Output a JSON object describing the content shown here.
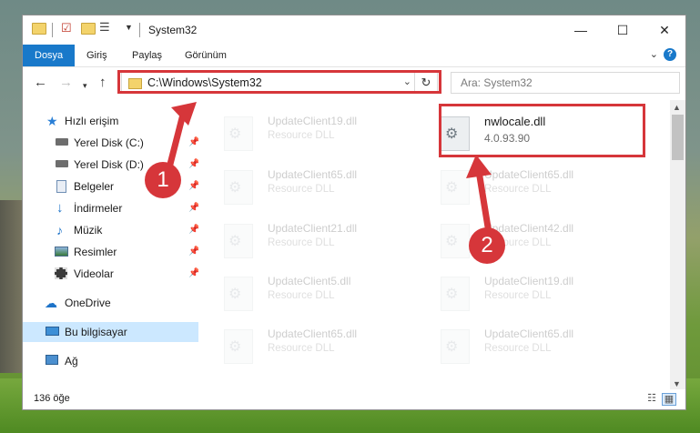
{
  "window": {
    "title": "System32",
    "controls": {
      "minimize": "—",
      "maximize": "☐",
      "close": "✕"
    }
  },
  "ribbon": {
    "tabs": [
      "Dosya",
      "Giriş",
      "Paylaş",
      "Görünüm"
    ],
    "help": "?"
  },
  "address": {
    "path": "C:\\Windows\\System32",
    "search_placeholder": "Ara: System32"
  },
  "navpane": {
    "quick_access": "Hızlı erişim",
    "items": [
      {
        "label": "Yerel Disk (C:)",
        "icon": "drive-icon"
      },
      {
        "label": "Yerel Disk (D:)",
        "icon": "drive-icon"
      },
      {
        "label": "Belgeler",
        "icon": "documents-icon"
      },
      {
        "label": "İndirmeler",
        "icon": "download-icon"
      },
      {
        "label": "Müzik",
        "icon": "music-icon"
      },
      {
        "label": "Resimler",
        "icon": "pictures-icon"
      },
      {
        "label": "Videolar",
        "icon": "videos-icon"
      }
    ],
    "onedrive": "OneDrive",
    "this_pc": "Bu bilgisayar",
    "network": "Ağ"
  },
  "files": {
    "highlighted": {
      "name": "nwlocale.dll",
      "desc": "4.0.93.90"
    },
    "left_column": [
      {
        "name": "UpdateClient19.dll",
        "desc": "Resource DLL"
      },
      {
        "name": "UpdateClient65.dll",
        "desc": "Resource DLL"
      },
      {
        "name": "UpdateClient21.dll",
        "desc": "Resource DLL"
      },
      {
        "name": "UpdateClient5.dll",
        "desc": "Resource DLL"
      },
      {
        "name": "UpdateClient65.dll",
        "desc": "Resource DLL"
      }
    ],
    "right_column": [
      {
        "name": "UpdateClient65.dll",
        "desc": "Resource DLL"
      },
      {
        "name": "UpdateClient42.dll",
        "desc": "Resource DLL"
      },
      {
        "name": "UpdateClient19.dll",
        "desc": "Resource DLL"
      },
      {
        "name": "UpdateClient65.dll",
        "desc": "Resource DLL"
      }
    ]
  },
  "status": {
    "count": "136 öğe"
  },
  "annotations": {
    "step1": "1",
    "step2": "2",
    "color": "#d6363a"
  }
}
